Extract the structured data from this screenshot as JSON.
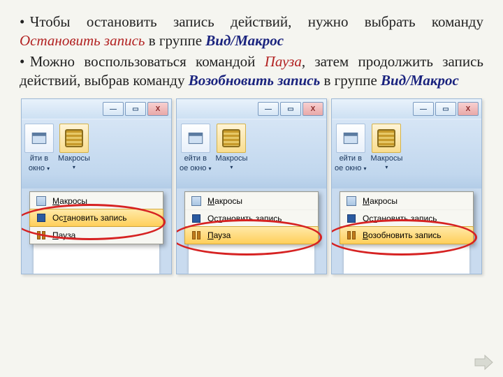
{
  "para1": {
    "t1": "Чтобы остановить запись действий, нужно выбрать команду ",
    "cmd": "Остановить запись",
    "t2": " в группе ",
    "grp": "Вид/Макрос"
  },
  "para2": {
    "t1": "Можно воспользоваться командой ",
    "cmd1": "Пауза",
    "t2": ", затем продолжить запись действий, выбрав команду ",
    "cmd2": "Возобновить запись",
    "t3": " в группе ",
    "grp": "Вид/Макрос"
  },
  "win": {
    "min": "—",
    "max": "▭",
    "close": "X"
  },
  "ribbon": {
    "window_part1": "йти в",
    "window_part2": "окно",
    "window2_part1": "ейти в",
    "window2_part2": "ое окно",
    "macros": "Макросы",
    "arrow": "▾"
  },
  "menu": {
    "m1": "Макросы",
    "m2": "Остановить запись",
    "m3": "Пауза",
    "m4": "Возобновить запись"
  },
  "underline": {
    "m1_pre": "",
    "m1_u": "М",
    "m1_post": "акросы",
    "m2_pre": "Ос",
    "m2_u": "т",
    "m2_post": "ановить запись",
    "m3_pre": "",
    "m3_u": "П",
    "m3_post": "ауза",
    "m4_pre": "",
    "m4_u": "В",
    "m4_post": "озобновить запись"
  }
}
